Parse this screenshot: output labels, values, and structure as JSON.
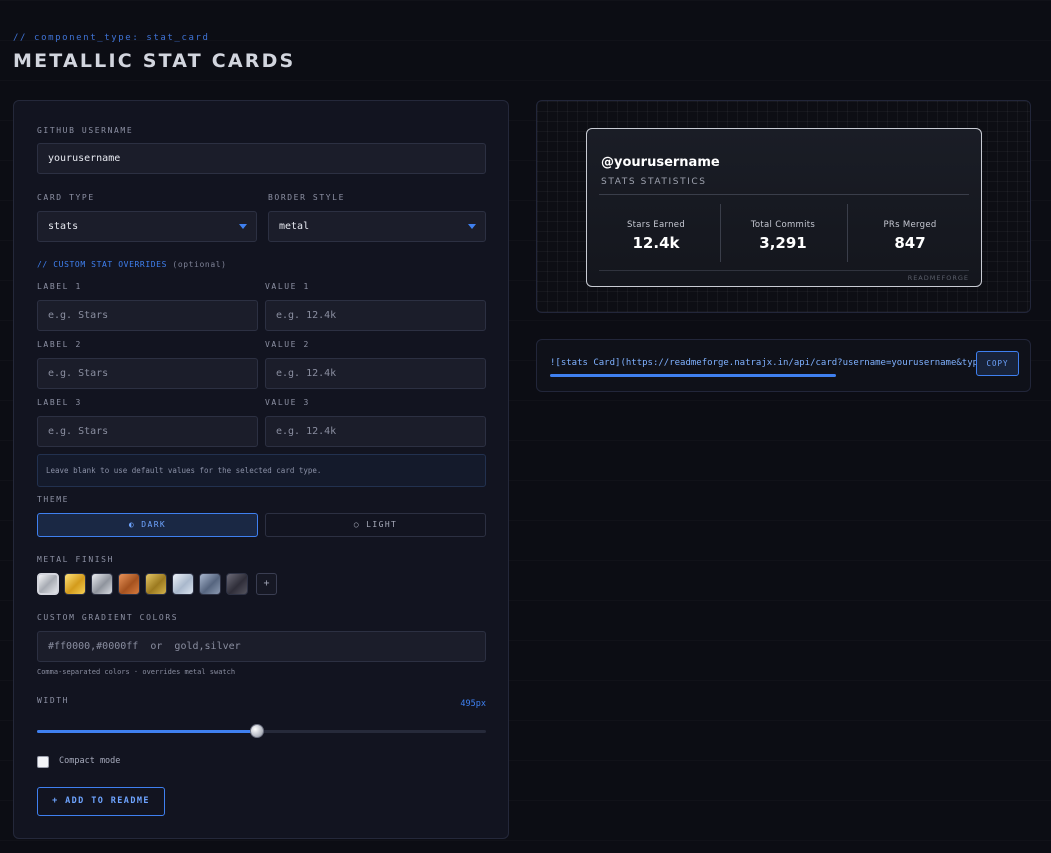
{
  "header": {
    "comment": "// component_type: stat_card",
    "title": "METALLIC STAT CARDS"
  },
  "form": {
    "username_label": "GITHUB USERNAME",
    "username_value": "yourusername",
    "card_type_label": "CARD TYPE",
    "card_type_value": "stats",
    "border_style_label": "BORDER STYLE",
    "border_style_value": "metal",
    "overrides_comment": "// CUSTOM STAT OVERRIDES",
    "overrides_optional": "(optional)",
    "overrides": [
      {
        "label_title": "LABEL 1",
        "label_placeholder": "e.g. Stars",
        "value_title": "VALUE 1",
        "value_placeholder": "e.g. 12.4k"
      },
      {
        "label_title": "LABEL 2",
        "label_placeholder": "e.g. Stars",
        "value_title": "VALUE 2",
        "value_placeholder": "e.g. 12.4k"
      },
      {
        "label_title": "LABEL 3",
        "label_placeholder": "e.g. Stars",
        "value_title": "VALUE 3",
        "value_placeholder": "e.g. 12.4k"
      }
    ],
    "overrides_hint": "Leave blank to use default values for the selected card type.",
    "theme_label": "THEME",
    "theme_dark": "◐ DARK",
    "theme_light": "○ LIGHT",
    "theme_selected": "dark",
    "metal_finish_label": "METAL FINISH",
    "metal_swatches": [
      {
        "name": "silver",
        "gradient": "linear-gradient(135deg,#f4f5f7,#a7abb3 50%,#e4e6ea)",
        "selected": true
      },
      {
        "name": "gold",
        "gradient": "linear-gradient(135deg,#ffe27a,#d39b1c 55%,#f6cf55)",
        "selected": false
      },
      {
        "name": "chrome",
        "gradient": "linear-gradient(135deg,#eceef2,#8f949d 55%,#d9dce2)",
        "selected": false
      },
      {
        "name": "copper",
        "gradient": "linear-gradient(135deg,#e8935a,#a5521f 55%,#d77b3e)",
        "selected": false
      },
      {
        "name": "brass",
        "gradient": "linear-gradient(135deg,#e5c766,#9c7a1f 55%,#d4b34c)",
        "selected": false
      },
      {
        "name": "platinum",
        "gradient": "linear-gradient(135deg,#eef3fa,#a9b8cc 55%,#dbe4ef)",
        "selected": false
      },
      {
        "name": "steel",
        "gradient": "linear-gradient(135deg,#a9b7cf,#56657f 55%,#8c9ab2)",
        "selected": false
      },
      {
        "name": "gunmetal",
        "gradient": "linear-gradient(135deg,#6c6b78,#2f2e39 55%,#55545f)",
        "selected": false
      }
    ],
    "add_swatch": "+",
    "gradient_label": "CUSTOM GRADIENT COLORS",
    "gradient_value": "#ff0000,#0000ff  or  gold,silver",
    "gradient_note": "Comma-separated colors · overrides metal swatch",
    "width_label": "WIDTH",
    "width_value": "495px",
    "width_fraction": 0.49,
    "compact_label": "Compact mode",
    "compact_checked": false,
    "add_button": "+ ADD TO README"
  },
  "preview": {
    "username": "@yourusername",
    "subtitle": "STATS STATISTICS",
    "stats": [
      {
        "label": "Stars Earned",
        "value": "12.4k"
      },
      {
        "label": "Total Commits",
        "value": "3,291"
      },
      {
        "label": "PRs Merged",
        "value": "847"
      }
    ],
    "brand": "READMEFORGE"
  },
  "code": {
    "snippet": "![stats Card](https://readmeforge.natrajx.in/api/card?username=yourusername&type=stats&metal=silver)",
    "copy_label": "COPY"
  },
  "colors": {
    "accent": "#3f80f0",
    "background": "#0c0d14",
    "panel": "#121420"
  }
}
